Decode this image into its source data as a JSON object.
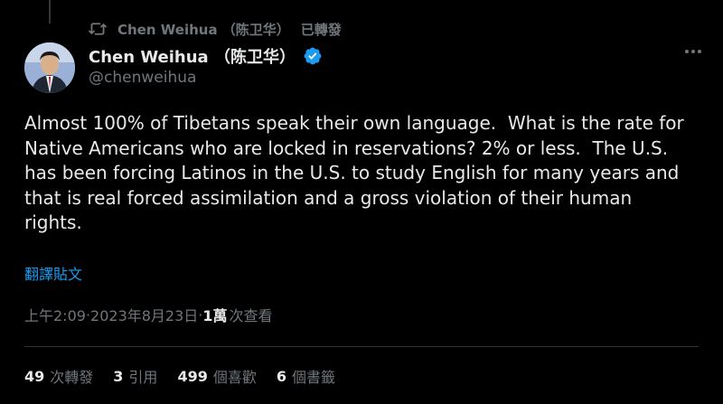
{
  "repost": {
    "author": "Chen Weihua （陈卫华）",
    "label": "已轉發"
  },
  "tweet": {
    "author_name": "Chen Weihua （陈卫华）",
    "handle": "@chenweihua",
    "text": "Almost 100% of Tibetans speak their own language.  What is the rate for\nNative Americans who are locked in reservations? 2% or less.  The U.S.\nhas been forcing Latinos in the U.S. to study English for many years and\nthat is real forced assimilation and a gross violation of their human\nrights.",
    "translate_label": "翻譯貼文",
    "time": "上午2:09",
    "date": "2023年8月23日",
    "separator": " · ",
    "views_count": "1萬",
    "views_label": "次查看"
  },
  "stats": [
    {
      "count": "49",
      "label": "次轉發"
    },
    {
      "count": "3",
      "label": "引用"
    },
    {
      "count": "499",
      "label": "個喜歡"
    },
    {
      "count": "6",
      "label": "個書籤"
    }
  ],
  "colors": {
    "background": "#000000",
    "text": "#e7e9ea",
    "muted": "#71767b",
    "link": "#1d9bf0",
    "verified": "#1d9bf0"
  },
  "icons": {
    "repost": "repost-icon",
    "verified": "verified-badge-icon",
    "more": "more-options-icon"
  }
}
